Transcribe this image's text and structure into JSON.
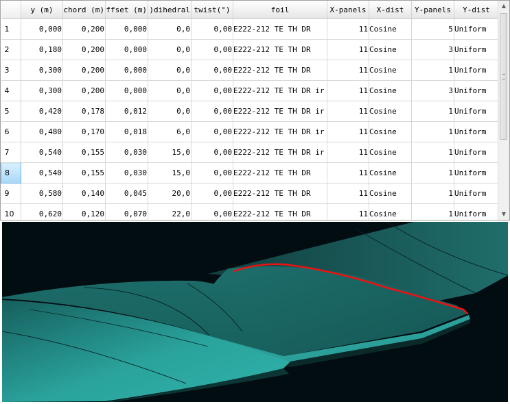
{
  "table": {
    "columns": [
      "y (m)",
      "chord (m)",
      "offset (m)",
      "dihedral(°)",
      "twist(°)",
      "foil",
      "X-panels",
      "X-dist",
      "Y-panels",
      "Y-dist"
    ],
    "rows": [
      {
        "n": "1",
        "y": "0,000",
        "chord": "0,200",
        "offset": "0,000",
        "dihedral": "0,0",
        "twist": "0,00",
        "foil": "E222-212 TE TH DR",
        "xpanels": "11",
        "xdist": "Cosine",
        "ypanels": "5",
        "ydist": "Uniform"
      },
      {
        "n": "2",
        "y": "0,180",
        "chord": "0,200",
        "offset": "0,000",
        "dihedral": "0,0",
        "twist": "0,00",
        "foil": "E222-212 TE TH DR",
        "xpanels": "11",
        "xdist": "Cosine",
        "ypanels": "3",
        "ydist": "Uniform"
      },
      {
        "n": "3",
        "y": "0,300",
        "chord": "0,200",
        "offset": "0,000",
        "dihedral": "0,0",
        "twist": "0,00",
        "foil": "E222-212 TE TH DR",
        "xpanels": "11",
        "xdist": "Cosine",
        "ypanels": "1",
        "ydist": "Uniform"
      },
      {
        "n": "4",
        "y": "0,300",
        "chord": "0,200",
        "offset": "0,000",
        "dihedral": "0,0",
        "twist": "0,00",
        "foil": "E222-212 TE TH DR ir",
        "xpanels": "11",
        "xdist": "Cosine",
        "ypanels": "3",
        "ydist": "Uniform"
      },
      {
        "n": "5",
        "y": "0,420",
        "chord": "0,178",
        "offset": "0,012",
        "dihedral": "0,0",
        "twist": "0,00",
        "foil": "E222-212 TE TH DR ir",
        "xpanels": "11",
        "xdist": "Cosine",
        "ypanels": "1",
        "ydist": "Uniform"
      },
      {
        "n": "6",
        "y": "0,480",
        "chord": "0,170",
        "offset": "0,018",
        "dihedral": "6,0",
        "twist": "0,00",
        "foil": "E222-212 TE TH DR ir",
        "xpanels": "11",
        "xdist": "Cosine",
        "ypanels": "1",
        "ydist": "Uniform"
      },
      {
        "n": "7",
        "y": "0,540",
        "chord": "0,155",
        "offset": "0,030",
        "dihedral": "15,0",
        "twist": "0,00",
        "foil": "E222-212 TE TH DR ir",
        "xpanels": "11",
        "xdist": "Cosine",
        "ypanels": "1",
        "ydist": "Uniform"
      },
      {
        "n": "8",
        "y": "0,540",
        "chord": "0,155",
        "offset": "0,030",
        "dihedral": "15,0",
        "twist": "0,00",
        "foil": "E222-212 TE TH DR",
        "xpanels": "11",
        "xdist": "Cosine",
        "ypanels": "1",
        "ydist": "Uniform"
      },
      {
        "n": "9",
        "y": "0,580",
        "chord": "0,140",
        "offset": "0,045",
        "dihedral": "20,0",
        "twist": "0,00",
        "foil": "E222-212 TE TH DR",
        "xpanels": "11",
        "xdist": "Cosine",
        "ypanels": "1",
        "ydist": "Uniform"
      },
      {
        "n": "10",
        "y": "0,620",
        "chord": "0,120",
        "offset": "0,070",
        "dihedral": "22,0",
        "twist": "0,00",
        "foil": "E222-212 TE TH DR",
        "xpanels": "11",
        "xdist": "Cosine",
        "ypanels": "1",
        "ydist": "Uniform"
      }
    ],
    "selected_row": "8"
  },
  "icons": {
    "scroll_up": "scroll-up-arrow-icon",
    "scroll_down": "scroll-down-arrow-icon",
    "scroll_grip": "scroll-grip-icon"
  },
  "colors": {
    "viewport_background": "#020d12",
    "wing_surface": "#1f7f7b",
    "wing_highlight": "#2fb3ab",
    "wing_shadow": "#0f3d3d",
    "panel_lines": "#062222",
    "selection_curve": "#ee1111",
    "row_selected": "#a8d8f7"
  }
}
